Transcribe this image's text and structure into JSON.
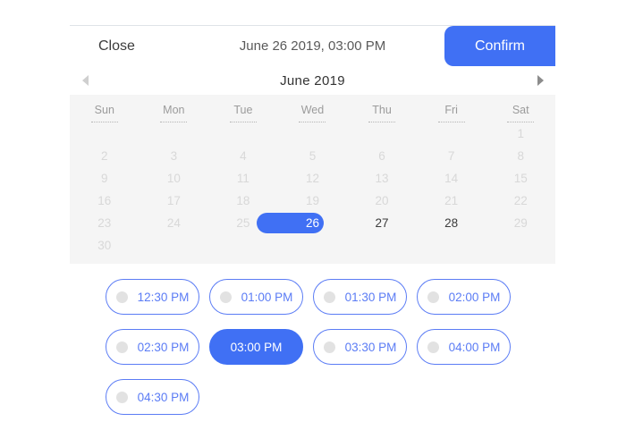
{
  "header": {
    "close_label": "Close",
    "title": "June 26 2019, 03:00 PM",
    "confirm_label": "Confirm"
  },
  "month_nav": {
    "prev_icon": "triangle-left-icon",
    "next_icon": "triangle-right-icon",
    "month_label": "June 2019"
  },
  "calendar": {
    "weekdays": [
      "Sun",
      "Mon",
      "Tue",
      "Wed",
      "Thu",
      "Fri",
      "Sat"
    ],
    "weeks": [
      [
        {
          "label": "",
          "state": "empty"
        },
        {
          "label": "",
          "state": "empty"
        },
        {
          "label": "",
          "state": "empty"
        },
        {
          "label": "",
          "state": "empty"
        },
        {
          "label": "",
          "state": "empty"
        },
        {
          "label": "",
          "state": "empty"
        },
        {
          "label": "1",
          "state": "disabled"
        }
      ],
      [
        {
          "label": "2",
          "state": "disabled"
        },
        {
          "label": "3",
          "state": "disabled"
        },
        {
          "label": "4",
          "state": "disabled"
        },
        {
          "label": "5",
          "state": "disabled"
        },
        {
          "label": "6",
          "state": "disabled"
        },
        {
          "label": "7",
          "state": "disabled"
        },
        {
          "label": "8",
          "state": "disabled"
        }
      ],
      [
        {
          "label": "9",
          "state": "disabled"
        },
        {
          "label": "10",
          "state": "disabled"
        },
        {
          "label": "11",
          "state": "disabled"
        },
        {
          "label": "12",
          "state": "disabled"
        },
        {
          "label": "13",
          "state": "disabled"
        },
        {
          "label": "14",
          "state": "disabled"
        },
        {
          "label": "15",
          "state": "disabled"
        }
      ],
      [
        {
          "label": "16",
          "state": "disabled"
        },
        {
          "label": "17",
          "state": "disabled"
        },
        {
          "label": "18",
          "state": "disabled"
        },
        {
          "label": "19",
          "state": "disabled"
        },
        {
          "label": "20",
          "state": "disabled"
        },
        {
          "label": "21",
          "state": "disabled"
        },
        {
          "label": "22",
          "state": "disabled"
        }
      ],
      [
        {
          "label": "23",
          "state": "disabled"
        },
        {
          "label": "24",
          "state": "disabled"
        },
        {
          "label": "25",
          "state": "disabled"
        },
        {
          "label": "26",
          "state": "selected"
        },
        {
          "label": "27",
          "state": "enabled"
        },
        {
          "label": "28",
          "state": "enabled"
        },
        {
          "label": "29",
          "state": "disabled"
        }
      ],
      [
        {
          "label": "30",
          "state": "disabled"
        },
        {
          "label": "",
          "state": "empty"
        },
        {
          "label": "",
          "state": "empty"
        },
        {
          "label": "",
          "state": "empty"
        },
        {
          "label": "",
          "state": "empty"
        },
        {
          "label": "",
          "state": "empty"
        },
        {
          "label": "",
          "state": "empty"
        }
      ]
    ]
  },
  "time_slots": [
    {
      "label": "12:30 PM",
      "selected": false
    },
    {
      "label": "01:00 PM",
      "selected": false
    },
    {
      "label": "01:30 PM",
      "selected": false
    },
    {
      "label": "02:00 PM",
      "selected": false
    },
    {
      "label": "02:30 PM",
      "selected": false
    },
    {
      "label": "03:00 PM",
      "selected": true
    },
    {
      "label": "03:30 PM",
      "selected": false
    },
    {
      "label": "04:00 PM",
      "selected": false
    },
    {
      "label": "04:30 PM",
      "selected": false
    }
  ],
  "colors": {
    "accent": "#4070f4",
    "slot_border": "#5b7cf5",
    "calendar_bg": "#f5f5f5",
    "disabled_text": "#d8d8d8",
    "dot": "#e2e2e2"
  }
}
